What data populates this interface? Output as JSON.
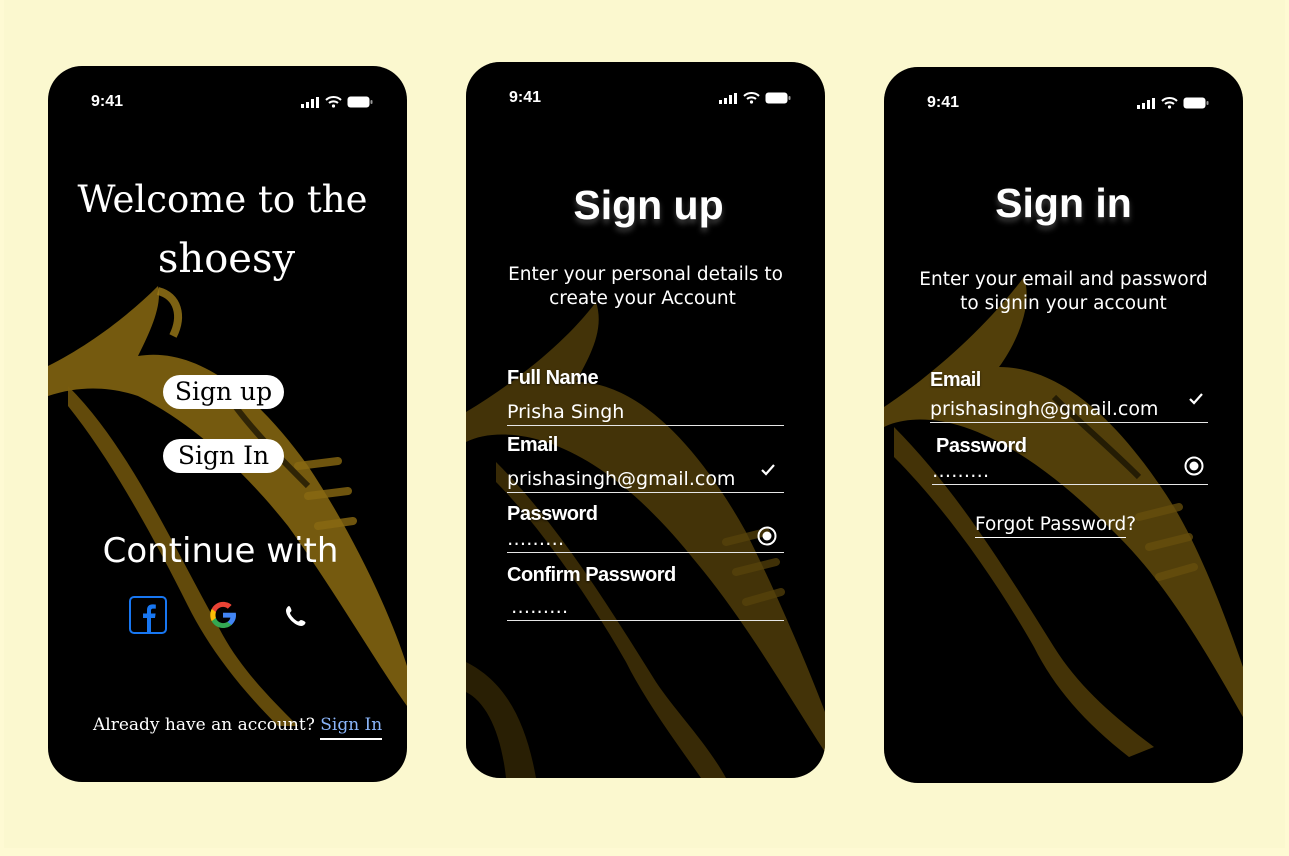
{
  "colors": {
    "background": "#fbf8cf",
    "phone": "#000000",
    "accent_gold": "#8a6a12",
    "link_blue": "#8ab4f8"
  },
  "status": {
    "time": "9:41"
  },
  "welcome": {
    "title_line1": "Welcome to the",
    "title_line2": "shoesy",
    "signup_label": "Sign up",
    "signin_label": "Sign In",
    "continue_label": "Continue with",
    "socials": [
      "facebook-icon",
      "google-icon",
      "phone-icon"
    ],
    "footer_prefix": "Already have an account?",
    "footer_link": "Sign In"
  },
  "signup": {
    "title": "Sign up",
    "subtitle_line1": "Enter your personal details to",
    "subtitle_line2": "create your Account",
    "fields": [
      {
        "label": "Full Name",
        "value": "Prisha Singh"
      },
      {
        "label": "Email",
        "value": "prishasingh@gmail.com"
      },
      {
        "label": "Password",
        "value": "․․․․․․․․․"
      },
      {
        "label": "Confirm Password",
        "value": "․․․․․․․․․"
      }
    ]
  },
  "signin": {
    "title": "Sign in",
    "subtitle_line1": "Enter your email and password",
    "subtitle_line2": "to signin your account",
    "fields": [
      {
        "label": "Email",
        "value": "prishasingh@gmail.com"
      },
      {
        "label": "Password",
        "value": "․․․․․․․․․"
      }
    ],
    "forgot_main": "Forgot Password",
    "forgot_suffix": "?"
  }
}
